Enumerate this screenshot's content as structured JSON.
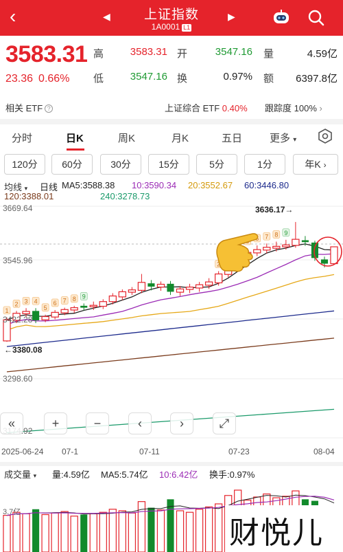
{
  "header": {
    "back_icon": "back-arrow-icon",
    "title": "上证指数",
    "code": "1A0001",
    "level": "L1",
    "prev_icon": "triangle-left-icon",
    "next_icon": "triangle-right-icon",
    "robot_icon": "robot-icon",
    "search_icon": "search-icon",
    "bg_color": "#e5232b"
  },
  "quote": {
    "price": "3583.31",
    "change": "23.36",
    "change_pct": "0.66%",
    "stats": [
      {
        "label": "高",
        "value": "3583.31",
        "color": "red"
      },
      {
        "label": "开",
        "value": "3547.16",
        "color": "green"
      },
      {
        "label": "量",
        "value": "4.59亿",
        "color": "dark"
      },
      {
        "label": "低",
        "value": "3547.16",
        "color": "green"
      },
      {
        "label": "换",
        "value": "0.97%",
        "color": "dark"
      },
      {
        "label": "额",
        "value": "6397.8亿",
        "color": "dark"
      }
    ]
  },
  "etf": {
    "related_label": "相关 ETF",
    "composite_label": "上证综合 ETF",
    "composite_value": "0.40%",
    "tracking_label": "跟踪度",
    "tracking_value": "100%"
  },
  "tabs": [
    "分时",
    "日K",
    "周K",
    "月K",
    "五日",
    "更多"
  ],
  "active_tab": "日K",
  "periods": [
    "120分",
    "60分",
    "30分",
    "15分",
    "5分",
    "1分",
    "年K"
  ],
  "ma": {
    "selector": "均线",
    "kline_label": "日线",
    "ma5": "MA5:3588.38",
    "ma10": "10:3590.34",
    "ma20": "20:3552.67",
    "ma60": "60:3446.80",
    "ma120": "120:3388.01",
    "ma240": "240:3278.73",
    "colors": {
      "ma5": "#222222",
      "ma10": "#9b2bb5",
      "ma20": "#e6a817",
      "ma60": "#1c2a8c",
      "ma120": "#7a3b1c",
      "ma240": "#1a9a6a"
    }
  },
  "chart_data": {
    "type": "candlestick",
    "y_labels": [
      "3669.64",
      "3545.96",
      "3422.28",
      "3298.60",
      "3174.92"
    ],
    "x_labels": [
      "2025-06-24",
      "07-1",
      "07-11",
      "07-23",
      "08-04"
    ],
    "annotations": {
      "high": "3636.17→",
      "low": "←3380.08"
    },
    "candles": [
      {
        "open": 3382,
        "close": 3427,
        "high": 3432,
        "low": 3380,
        "up": true,
        "marker": "1"
      },
      {
        "open": 3426,
        "close": 3441,
        "high": 3446,
        "low": 3420,
        "up": true,
        "marker": "2"
      },
      {
        "open": 3440,
        "close": 3445,
        "high": 3452,
        "low": 3433,
        "up": true,
        "marker": "3"
      },
      {
        "open": 3446,
        "close": 3426,
        "high": 3452,
        "low": 3420,
        "up": false,
        "marker": "4"
      },
      {
        "open": 3427,
        "close": 3434,
        "high": 3438,
        "low": 3422,
        "up": true,
        "marker": "5"
      },
      {
        "open": 3433,
        "close": 3443,
        "high": 3448,
        "low": 3428,
        "up": true,
        "marker": "6"
      },
      {
        "open": 3442,
        "close": 3449,
        "high": 3453,
        "low": 3437,
        "up": true,
        "marker": "7"
      },
      {
        "open": 3448,
        "close": 3453,
        "high": 3457,
        "low": 3442,
        "up": true,
        "marker": "8"
      },
      {
        "open": 3453,
        "close": 3457,
        "high": 3462,
        "low": 3447,
        "up": false,
        "marker": "9"
      },
      {
        "open": 3455,
        "close": 3458,
        "high": 3466,
        "low": 3448,
        "up": true,
        "marker": ""
      },
      {
        "open": 3456,
        "close": 3466,
        "high": 3471,
        "low": 3450,
        "up": true,
        "marker": ""
      },
      {
        "open": 3466,
        "close": 3478,
        "high": 3484,
        "low": 3460,
        "up": true,
        "marker": ""
      },
      {
        "open": 3476,
        "close": 3487,
        "high": 3492,
        "low": 3469,
        "up": true,
        "marker": ""
      },
      {
        "open": 3486,
        "close": 3491,
        "high": 3497,
        "low": 3480,
        "up": true,
        "marker": ""
      },
      {
        "open": 3490,
        "close": 3507,
        "high": 3525,
        "low": 3484,
        "up": true,
        "marker": ""
      },
      {
        "open": 3505,
        "close": 3498,
        "high": 3512,
        "low": 3490,
        "up": false,
        "marker": ""
      },
      {
        "open": 3497,
        "close": 3503,
        "high": 3509,
        "low": 3489,
        "up": true,
        "marker": ""
      },
      {
        "open": 3504,
        "close": 3487,
        "high": 3510,
        "low": 3480,
        "up": false,
        "marker": ""
      },
      {
        "open": 3486,
        "close": 3493,
        "high": 3499,
        "low": 3478,
        "up": true,
        "marker": ""
      },
      {
        "open": 3492,
        "close": 3497,
        "high": 3504,
        "low": 3484,
        "up": true,
        "marker": ""
      },
      {
        "open": 3495,
        "close": 3502,
        "high": 3508,
        "low": 3487,
        "up": true,
        "marker": ""
      },
      {
        "open": 3501,
        "close": 3508,
        "high": 3516,
        "low": 3493,
        "up": true,
        "marker": ""
      },
      {
        "open": 3506,
        "close": 3525,
        "high": 3531,
        "low": 3500,
        "up": true,
        "marker": "2"
      },
      {
        "open": 3524,
        "close": 3550,
        "high": 3557,
        "low": 3518,
        "up": true,
        "marker": "3"
      },
      {
        "open": 3548,
        "close": 3568,
        "high": 3575,
        "low": 3543,
        "up": true,
        "marker": "4"
      },
      {
        "open": 3566,
        "close": 3571,
        "high": 3580,
        "low": 3560,
        "up": true,
        "marker": "5"
      },
      {
        "open": 3570,
        "close": 3577,
        "high": 3586,
        "low": 3563,
        "up": true,
        "marker": "6"
      },
      {
        "open": 3576,
        "close": 3582,
        "high": 3590,
        "low": 3569,
        "up": true,
        "marker": "7"
      },
      {
        "open": 3580,
        "close": 3584,
        "high": 3594,
        "low": 3573,
        "up": true,
        "marker": "8"
      },
      {
        "open": 3583,
        "close": 3587,
        "high": 3598,
        "low": 3577,
        "up": true,
        "marker": "9"
      },
      {
        "open": 3586,
        "close": 3599,
        "high": 3636,
        "low": 3581,
        "up": true,
        "marker": ""
      },
      {
        "open": 3597,
        "close": 3593,
        "high": 3606,
        "low": 3585,
        "up": false,
        "marker": ""
      },
      {
        "open": 3592,
        "close": 3559,
        "high": 3596,
        "low": 3553,
        "up": false,
        "marker": ""
      },
      {
        "open": 3556,
        "close": 3547,
        "high": 3562,
        "low": 3539,
        "up": false,
        "marker": ""
      },
      {
        "open": 3547,
        "close": 3583,
        "high": 3583,
        "low": 3547,
        "up": true,
        "marker": ""
      }
    ],
    "ylim": [
      3174.92,
      3669.64
    ]
  },
  "chart_controls": [
    "«",
    "+",
    "−",
    "‹",
    "›",
    "⤢"
  ],
  "volume": {
    "selector": "成交量",
    "vol": "量:4.59亿",
    "ma5": "MA5:5.74亿",
    "ma10": "10:6.42亿",
    "turnover": "换手:0.97%",
    "left_label": "3.7亿"
  },
  "watermark": "财悦儿"
}
